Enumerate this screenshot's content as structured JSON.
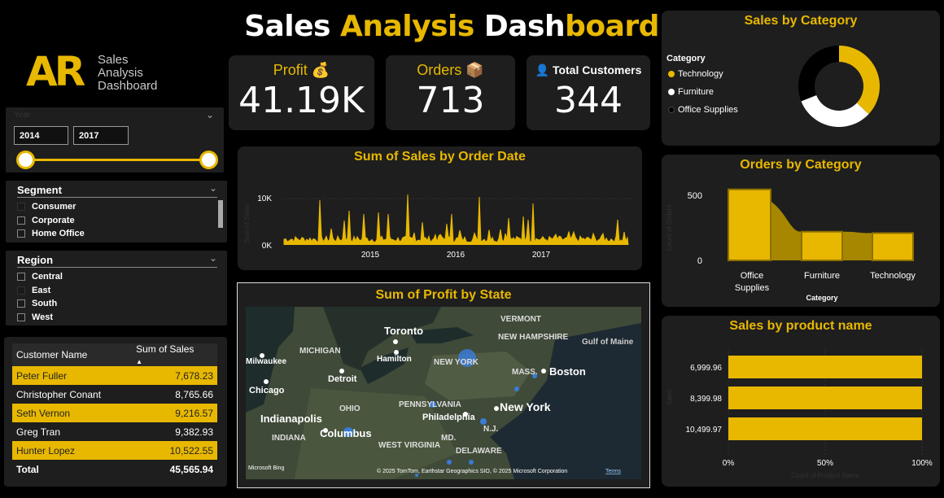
{
  "header": {
    "title_part1": "Sales",
    "title_part2": "Analysis",
    "title_part3": "Dash",
    "title_part4": "board"
  },
  "logo": {
    "mark": "AR",
    "text_line1": "Sales",
    "text_line2": "Analysis",
    "text_line3": "Dashboard"
  },
  "kpis": [
    {
      "label": "Profit 💰",
      "value": "41.19K"
    },
    {
      "label": "Orders 📦",
      "value": "713"
    },
    {
      "label": "👤 Total Customers",
      "value": "344"
    }
  ],
  "year_slicer": {
    "title": "Year",
    "start": "2014",
    "end": "2017"
  },
  "segment_slicer": {
    "title": "Segment",
    "items": [
      "Consumer",
      "Corporate",
      "Home Office"
    ]
  },
  "region_slicer": {
    "title": "Region",
    "items": [
      "Central",
      "East",
      "South",
      "West"
    ]
  },
  "customer_table": {
    "col1": "Customer Name",
    "col2": "Sum of Sales",
    "rows": [
      {
        "name": "Peter Fuller",
        "value": "7,678.23",
        "highlight": true
      },
      {
        "name": "Christopher Conant",
        "value": "8,765.66",
        "highlight": false
      },
      {
        "name": "Seth Vernon",
        "value": "9,216.57",
        "highlight": true
      },
      {
        "name": "Greg Tran",
        "value": "9,382.93",
        "highlight": false
      },
      {
        "name": "Hunter Lopez",
        "value": "10,522.55",
        "highlight": true
      }
    ],
    "total_label": "Total",
    "total_value": "45,565.94"
  },
  "sales_by_date": {
    "title": "Sum of Sales by Order Date",
    "ylabel": "Sum of Sales",
    "y_ticks": [
      "10K",
      "0K"
    ],
    "x_ticks": [
      "2015",
      "2016",
      "2017"
    ]
  },
  "map": {
    "title": "Sum of Profit by State",
    "labels": [
      "Toronto",
      "MICHIGAN",
      "Hamilton",
      "Milwaukee",
      "Detroit",
      "Chicago",
      "NEW YORK",
      "VERMONT",
      "NEW HAMPSHIRE",
      "Gulf of Maine",
      "MASS.",
      "Boston",
      "OHIO",
      "PENNSYLVANIA",
      "New York",
      "Indianapolis",
      "Philadelphia",
      "N.J.",
      "Columbus",
      "INDIANA",
      "WEST VIRGINIA",
      "MD.",
      "DELAWARE"
    ],
    "attribution": "© 2025 TomTom, Earthstar Geographics SIO, © 2025 Microsoft Corporation",
    "terms": "Terms",
    "brand": "Microsoft Bing"
  },
  "sales_by_category": {
    "title": "Sales by Category",
    "legend_title": "Category",
    "items": [
      {
        "name": "Technology",
        "color": "#e8b800"
      },
      {
        "name": "Furniture",
        "color": "#ffffff"
      },
      {
        "name": "Office Supplies",
        "color": "#000000"
      }
    ]
  },
  "orders_by_category": {
    "title": "Orders by Category",
    "ylabel": "Count of Orders",
    "xlabel": "Category",
    "y_ticks": [
      "500",
      "0"
    ],
    "categories": [
      "Office Supplies",
      "Furniture",
      "Technology"
    ]
  },
  "sales_by_product": {
    "title": "Sales by product name",
    "ylabel": "Sales",
    "xlabel": "Count of Product Name",
    "categories": [
      "6,999.96",
      "8,399.98",
      "10,499.97"
    ],
    "x_ticks": [
      "0%",
      "50%",
      "100%"
    ]
  },
  "chart_data": [
    {
      "type": "bar",
      "title": "Orders by Category",
      "categories": [
        "Office Supplies",
        "Furniture",
        "Technology"
      ],
      "values": [
        520,
        210,
        200
      ],
      "ylim": [
        0,
        560
      ]
    },
    {
      "type": "bar",
      "title": "Sales by product name",
      "categories": [
        "6,999.96",
        "8,399.98",
        "10,499.97"
      ],
      "values": [
        100,
        100,
        100
      ],
      "xlim": [
        0,
        100
      ]
    },
    {
      "type": "pie",
      "title": "Sales by Category",
      "categories": [
        "Technology",
        "Furniture",
        "Office Supplies"
      ],
      "values": [
        37,
        32,
        31
      ]
    }
  ]
}
